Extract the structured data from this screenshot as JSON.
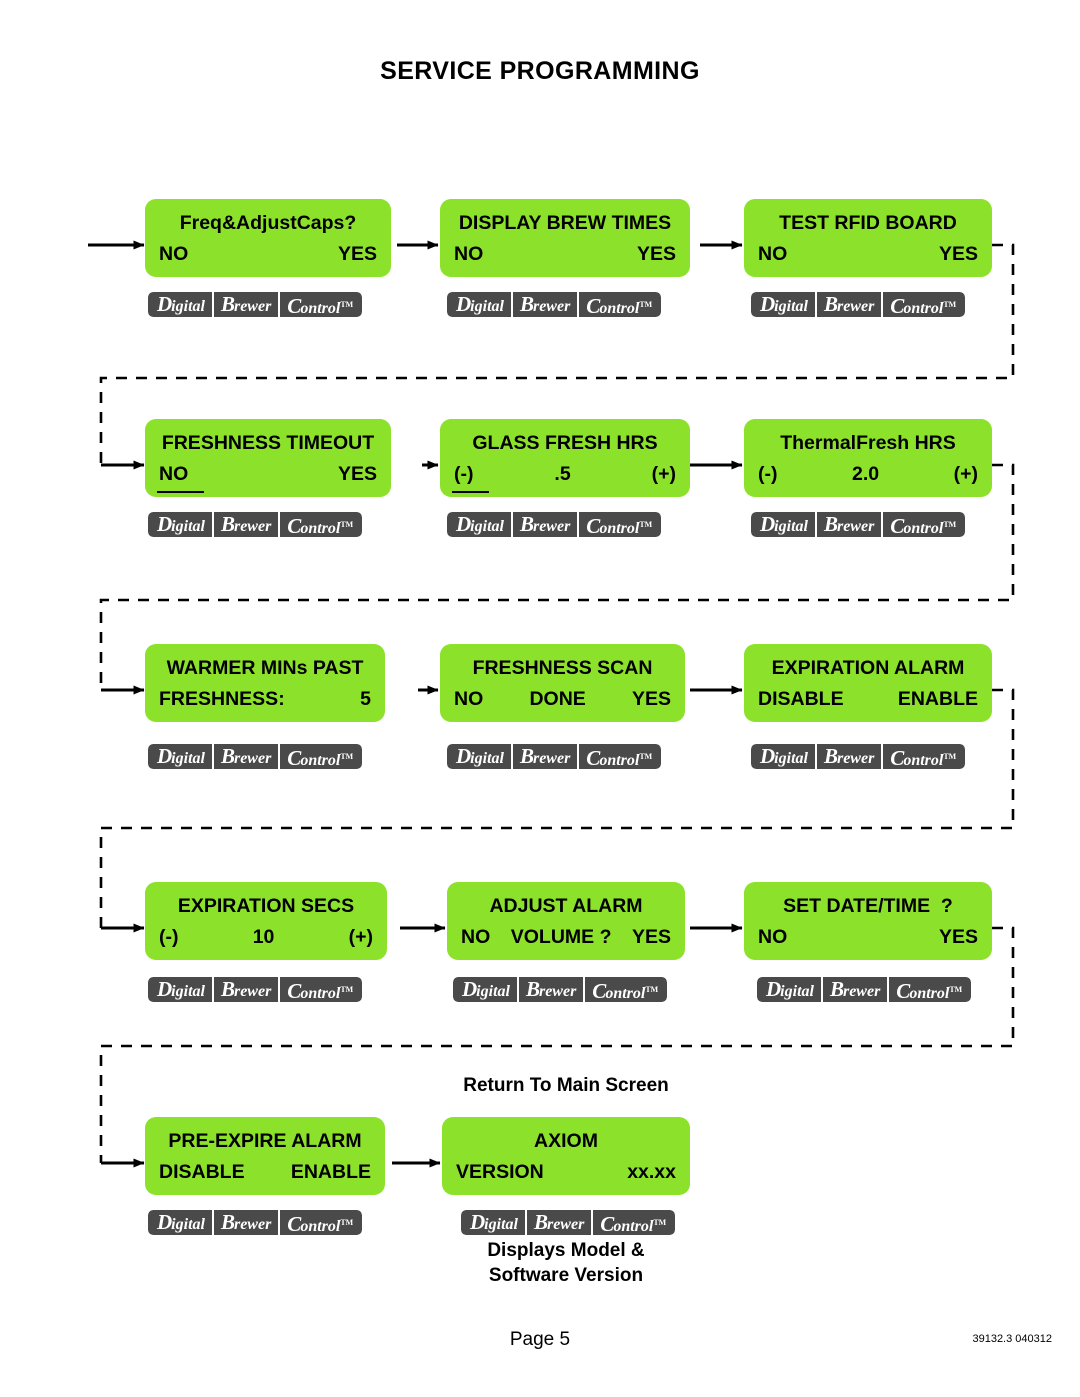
{
  "document": {
    "title": "SERVICE PROGRAMMING",
    "page_label": "Page 5",
    "doc_code": "39132.3 040312"
  },
  "brand": {
    "seg1_cap": "D",
    "seg1_rest": "igital",
    "seg2_cap": "B",
    "seg2_rest": "rewer",
    "seg3_cap": "C",
    "seg3_rest": "ontrol",
    "tm": "TM"
  },
  "captions": {
    "return_to_main": "Return To Main Screen",
    "displays_model_1": "Displays Model &",
    "displays_model_2": "Software Version"
  },
  "colors": {
    "lcd_green": "#8CE22B",
    "badge_gray": "#4a4a4a",
    "wire_black": "#000000"
  },
  "screens": [
    {
      "id": "freq-adjust-caps",
      "title": "Freq&AdjustCaps?",
      "title_case": "mixed",
      "left": "NO",
      "right": "YES",
      "middle": "",
      "cursor": "none"
    },
    {
      "id": "display-brew-times",
      "title": "DISPLAY BREW TIMES",
      "title_case": "upper",
      "left": "NO",
      "right": "YES",
      "middle": "",
      "cursor": "none"
    },
    {
      "id": "test-rfid-board",
      "title": "TEST RFID BOARD",
      "title_case": "upper",
      "left": "NO",
      "right": "YES",
      "middle": "",
      "cursor": "none"
    },
    {
      "id": "freshness-timeout",
      "title": "FRESHNESS TIMEOUT",
      "title_case": "upper",
      "left": "NO",
      "right": "YES",
      "middle": "",
      "cursor": "left"
    },
    {
      "id": "glass-fresh-hrs",
      "title": "GLASS FRESH HRS",
      "title_case": "upper",
      "left": "(-)",
      "middle": ".5",
      "right": "(+)",
      "cursor": "left"
    },
    {
      "id": "thermalfresh-hrs",
      "title": "ThermalFresh HRS",
      "title_case": "mixed",
      "left": "(-)",
      "middle": "2.0",
      "right": "(+)",
      "cursor": "none"
    },
    {
      "id": "warmer-mins-past",
      "title": "WARMER MINs PAST",
      "title_case": "mixed",
      "left": "FRESHNESS:",
      "middle": "",
      "right": "5",
      "cursor": "none"
    },
    {
      "id": "freshness-scan",
      "title": "FRESHNESS SCAN",
      "title_case": "upper",
      "left": "NO",
      "middle": "DONE",
      "right": "YES",
      "cursor": "none"
    },
    {
      "id": "expiration-alarm",
      "title": "EXPIRATION ALARM",
      "title_case": "upper",
      "left": "DISABLE",
      "middle": "",
      "right": "ENABLE",
      "cursor": "none"
    },
    {
      "id": "expiration-secs",
      "title": "EXPIRATION SECS",
      "title_case": "upper",
      "left": "(-)",
      "middle": "10",
      "right": "(+)",
      "cursor": "none"
    },
    {
      "id": "adjust-alarm",
      "title": "ADJUST ALARM",
      "title_case": "upper",
      "left": "NO",
      "middle": "VOLUME ?",
      "right": "YES",
      "cursor": "none"
    },
    {
      "id": "set-date-time",
      "title": "SET DATE/TIME  ?",
      "title_case": "upper",
      "left": "NO",
      "middle": "",
      "right": "YES",
      "cursor": "none"
    },
    {
      "id": "pre-expire-alarm",
      "title": "PRE-EXPIRE ALARM",
      "title_case": "upper",
      "left": "DISABLE",
      "middle": "",
      "right": "ENABLE",
      "cursor": "none"
    },
    {
      "id": "axiom-version",
      "title": "AXIOM",
      "title_case": "upper",
      "left": "VERSION",
      "middle": "",
      "right": "xx.xx",
      "cursor": "none"
    }
  ]
}
